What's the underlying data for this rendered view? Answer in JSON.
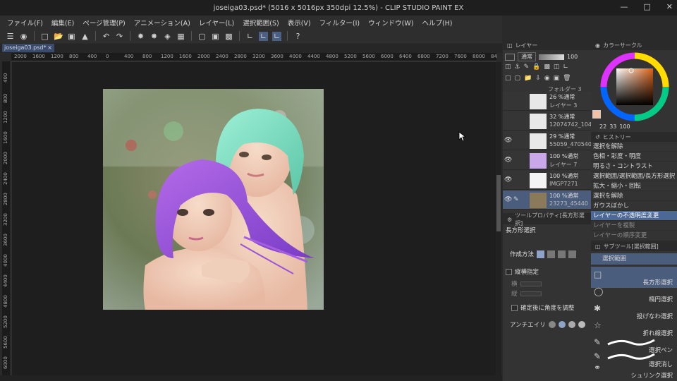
{
  "window": {
    "title": "joseiga03.psd* (5016 x 5016px 350dpi 12.5%) - CLIP STUDIO PAINT EX"
  },
  "menu": [
    "ファイル(F)",
    "編集(E)",
    "ページ管理(P)",
    "アニメーション(A)",
    "レイヤー(L)",
    "選択範囲(S)",
    "表示(V)",
    "フィルター(I)",
    "ウィンドウ(W)",
    "ヘルプ(H)"
  ],
  "document_tab": {
    "label": "joseiga03.psd*"
  },
  "ruler_h": [
    "2000",
    "1600",
    "1200",
    "800",
    "400",
    "0",
    "400",
    "800",
    "1200",
    "1600",
    "2000",
    "2400",
    "2800",
    "3200",
    "3600",
    "4000",
    "4400",
    "4800",
    "5200",
    "5600",
    "6000",
    "6400",
    "6800",
    "7200",
    "7600",
    "8000",
    "8400"
  ],
  "ruler_v": [
    "400",
    "800",
    "1200",
    "1600",
    "2000",
    "2400",
    "2800",
    "3200",
    "3600",
    "4000",
    "4400",
    "4800",
    "5200",
    "5600",
    "6000"
  ],
  "layer_panel": {
    "title": "レイヤー",
    "blend_mode": "通常",
    "opacity": "100",
    "top_folder": "フォルダー 3",
    "layers": [
      {
        "opacity": "26 %通常",
        "name": "レイヤー 3",
        "visible": false,
        "selected": false
      },
      {
        "opacity": "32 %通常",
        "name": "12074742_1048",
        "visible": false,
        "selected": false
      },
      {
        "opacity": "29 %通常",
        "name": "55059_470540",
        "visible": true,
        "selected": false
      },
      {
        "opacity": "100 %通常",
        "name": "レイヤー 7",
        "visible": true,
        "selected": false
      },
      {
        "opacity": "100 %通常",
        "name": "IMGP7271",
        "visible": true,
        "selected": false
      },
      {
        "opacity": "100 %通常",
        "name": "23273_45440",
        "visible": true,
        "selected": true
      }
    ]
  },
  "color_panel": {
    "title": "カラーサークル",
    "h": "22",
    "s": "33",
    "v": "100",
    "main_color": "#f2c2a2",
    "sub_color": "#6a5acd"
  },
  "history_panel": {
    "tabs": [
      "ヒストリー"
    ],
    "items": [
      {
        "label": "選択を解除",
        "state": "normal"
      },
      {
        "label": "色相・彩度・明度",
        "state": "normal"
      },
      {
        "label": "明るさ・コントラスト",
        "state": "normal"
      },
      {
        "label": "選択範囲/選択範囲/長方形選択",
        "state": "normal"
      },
      {
        "label": "拡大・縮小・回転",
        "state": "normal"
      },
      {
        "label": "選択を解除",
        "state": "normal"
      },
      {
        "label": "ガウスぼかし",
        "state": "normal"
      },
      {
        "label": "レイヤーの不透明度変更",
        "state": "selected"
      },
      {
        "label": "レイヤーを複製",
        "state": "dim"
      },
      {
        "label": "レイヤーの順序変更",
        "state": "dim"
      }
    ]
  },
  "tool_property": {
    "title": "ツールプロパティ[長方形選択]",
    "tool_name": "長方形選択",
    "creation_method_label": "作成方法",
    "aspect_label": "縦横指定",
    "width_label": "横",
    "height_label": "縦",
    "adjust_angle_label": "確定後に角度を調整",
    "antialias_label": "アンチエイリ"
  },
  "sub_tool": {
    "title": "サブツール[選択範囲]",
    "group": "選択範囲",
    "items": [
      {
        "label": "長方形選択",
        "icon": "rect-select-icon",
        "selected": true
      },
      {
        "label": "楕円選択",
        "icon": "ellipse-select-icon",
        "selected": false
      },
      {
        "label": "投げなわ選択",
        "icon": "lasso-icon",
        "selected": false
      },
      {
        "label": "折れ線選択",
        "icon": "polyline-icon",
        "selected": false
      },
      {
        "label": "選択ペン",
        "icon": "select-pen-icon",
        "selected": false
      },
      {
        "label": "選択消し",
        "icon": "select-eraser-icon",
        "selected": false
      },
      {
        "label": "シュリンク選択",
        "icon": "shrink-icon",
        "selected": false
      }
    ]
  },
  "colors": {
    "accent": "#4b6896",
    "panel": "#333333",
    "canvas": "#1e1e1e"
  }
}
